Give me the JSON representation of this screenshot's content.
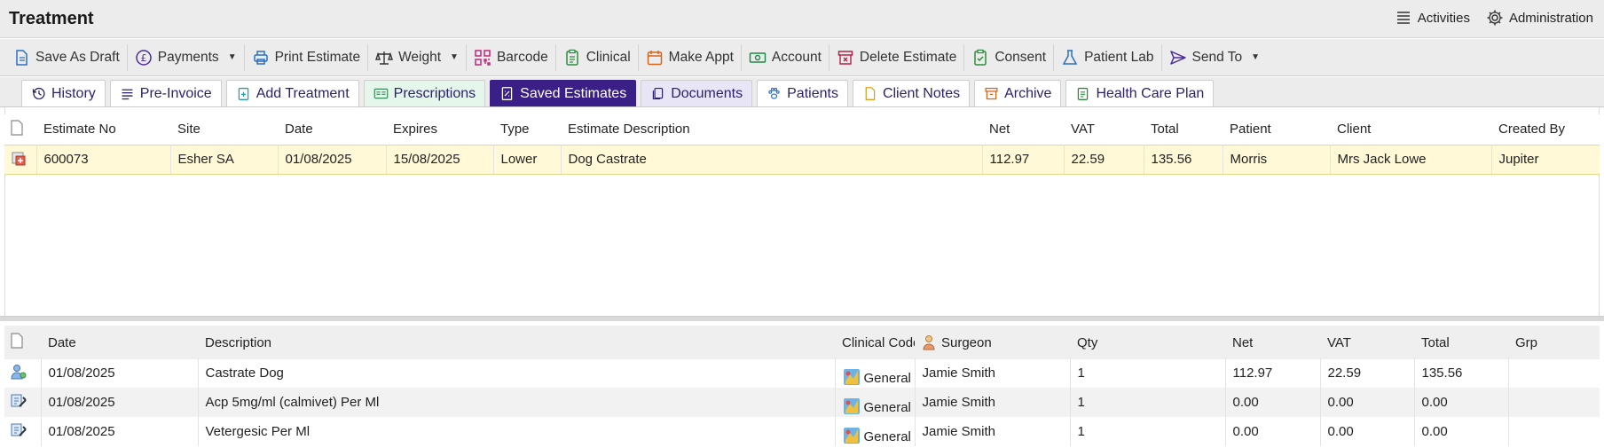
{
  "window": {
    "title": "Treatment"
  },
  "topbar": {
    "activities_label": "Activities",
    "administration_label": "Administration"
  },
  "toolbar": {
    "items": [
      {
        "label": "Save As Draft",
        "icon": "document-icon"
      },
      {
        "label": "Payments",
        "icon": "pound-icon",
        "dropdown": true
      },
      {
        "label": "Print Estimate",
        "icon": "printer-icon"
      },
      {
        "label": "Weight",
        "icon": "scales-icon",
        "dropdown": true
      },
      {
        "label": "Barcode",
        "icon": "qr-code-icon"
      },
      {
        "label": "Clinical",
        "icon": "clipboard-icon"
      },
      {
        "label": "Make Appt",
        "icon": "calendar-icon"
      },
      {
        "label": "Account",
        "icon": "money-icon"
      },
      {
        "label": "Delete Estimate",
        "icon": "archive-delete-icon"
      },
      {
        "label": "Consent",
        "icon": "clipboard-check-icon"
      },
      {
        "label": "Patient Lab",
        "icon": "flask-icon"
      },
      {
        "label": "Send To",
        "icon": "send-icon",
        "dropdown": true
      }
    ]
  },
  "tabs": [
    {
      "label": "History",
      "icon": "history-icon"
    },
    {
      "label": "Pre-Invoice",
      "icon": "list-icon"
    },
    {
      "label": "Add Treatment",
      "icon": "clipboard-plus-icon"
    },
    {
      "label": "Prescriptions",
      "icon": "prescription-icon"
    },
    {
      "label": "Saved Estimates",
      "icon": "estimate-icon",
      "active": true
    },
    {
      "label": "Documents",
      "icon": "documents-icon"
    },
    {
      "label": "Patients",
      "icon": "paw-icon"
    },
    {
      "label": "Client Notes",
      "icon": "note-icon"
    },
    {
      "label": "Archive",
      "icon": "archive-icon"
    },
    {
      "label": "Health Care Plan",
      "icon": "care-plan-icon"
    }
  ],
  "estimates": {
    "columns": [
      "Estimate No",
      "Site",
      "Date",
      "Expires",
      "Type",
      "Estimate Description",
      "Net",
      "VAT",
      "Total",
      "Patient",
      "Client",
      "Created By"
    ],
    "rows": [
      {
        "estimate_no": "600073",
        "site": "Esher SA",
        "date": "01/08/2025",
        "expires": "15/08/2025",
        "type": "Lower",
        "description": "Dog Castrate",
        "net": "112.97",
        "vat": "22.59",
        "total": "135.56",
        "patient": "Morris",
        "client": "Mrs Jack Lowe",
        "created_by": "Jupiter"
      }
    ]
  },
  "items": {
    "columns": [
      "Date",
      "Description",
      "Clinical Code",
      "Surgeon",
      "Qty",
      "Net",
      "VAT",
      "Total",
      "Grp"
    ],
    "rows": [
      {
        "date": "01/08/2025",
        "description": "Castrate Dog",
        "code": "General",
        "surgeon": "Jamie Smith",
        "qty": "1",
        "net": "112.97",
        "vat": "22.59",
        "total": "135.56",
        "grp": ""
      },
      {
        "date": "01/08/2025",
        "description": "Acp 5mg/ml (calmivet) Per Ml",
        "code": "General",
        "surgeon": "Jamie Smith",
        "qty": "1",
        "net": "0.00",
        "vat": "0.00",
        "total": "0.00",
        "grp": ""
      },
      {
        "date": "01/08/2025",
        "description": "Vetergesic Per Ml",
        "code": "General",
        "surgeon": "Jamie Smith",
        "qty": "1",
        "net": "0.00",
        "vat": "0.00",
        "total": "0.00",
        "grp": ""
      }
    ]
  },
  "colors": {
    "accent": "#3a1f86",
    "selected_row": "#fff9d8",
    "toolbar_bg": "#ececec"
  }
}
